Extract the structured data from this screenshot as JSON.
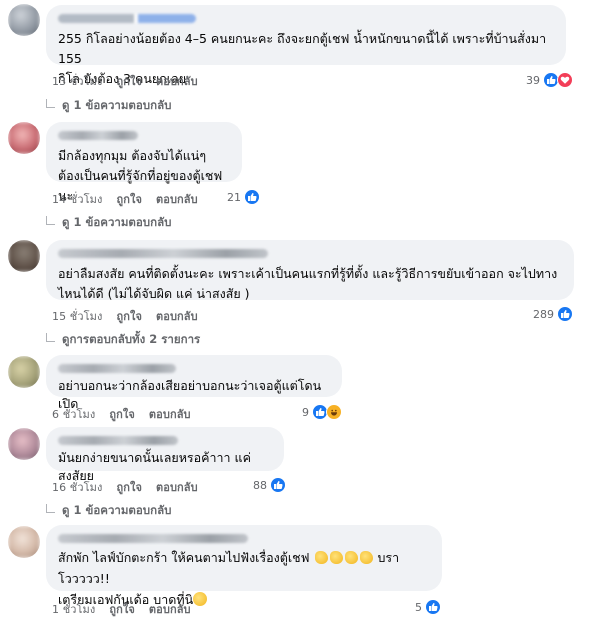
{
  "comments": [
    {
      "text": "255 กิโลอย่างน้อยต้อง 4–5 คนยกนะคะ ถึงจะยกตู้เชฟ น้ำหนักขนาดนี้ได้ เพราะที่บ้านสั่งมา 155\nกิโล ยังต้อง 3 คนยกเลย",
      "time": "13 ชั่วโมง",
      "like": "ถูกใจ",
      "reply": "ตอบกลับ",
      "reaction_count": "39",
      "reactions": [
        "like-icon",
        "love-icon"
      ],
      "replies_link": "ดู 1 ข้อความตอบกลับ"
    },
    {
      "text": "มีกล้องทุกมุม ต้องจับได้แน่ๆ\nต้องเป็นคนที่รู้จักที่อยู่ของตู้เชฟนะ",
      "time": "14 ชั่วโมง",
      "like": "ถูกใจ",
      "reply": "ตอบกลับ",
      "reaction_count": "21",
      "reactions": [
        "like-icon"
      ],
      "replies_link": "ดู 1 ข้อความตอบกลับ"
    },
    {
      "text": "อย่าลืมสงสัย คนที่ติดตั้งนะคะ เพราะเค้าเป็นคนแรกที่รู้ที่ตั้ง และรู้วิธีการขยับเข้าออก จะไปทาง\nไหนได้ดี (ไม่ได้จับผิด แค่ น่าสงสัย )",
      "time": "15 ชั่วโมง",
      "like": "ถูกใจ",
      "reply": "ตอบกลับ",
      "reaction_count": "289",
      "reactions": [
        "like-icon"
      ],
      "replies_link": "ดูการตอบกลับทั้ง 2 รายการ"
    },
    {
      "text": "อย่าบอกนะว่ากล้องเสียอย่าบอกนะว่าเจอตู้แต่โดนเปิด",
      "time": "6 ชั่วโมง",
      "like": "ถูกใจ",
      "reply": "ตอบกลับ",
      "reaction_count": "9",
      "reactions": [
        "like-icon",
        "haha-icon"
      ]
    },
    {
      "text": "มันยกง่ายขนาดนั้นเลยหรอค้าาา แค่สงสัยย",
      "time": "16 ชั่วโมง",
      "like": "ถูกใจ",
      "reply": "ตอบกลับ",
      "reaction_count": "88",
      "reactions": [
        "like-icon"
      ],
      "replies_link": "ดู 1 ข้อความตอบกลับ"
    },
    {
      "text_line1_a": "สักพัก ไลฟ์บักตะกร้า ให้คนตามไปฟังเรื่องตู้เชฟ",
      "text_line1_b": "บราโววววว!!",
      "text_line2": "เตรียมเอฟกันเด้อ บาดที่นิ",
      "time": "1 ชั่วโมง",
      "like": "ถูกใจ",
      "reply": "ตอบกลับ",
      "reaction_count": "5",
      "reactions": [
        "like-icon"
      ]
    }
  ]
}
